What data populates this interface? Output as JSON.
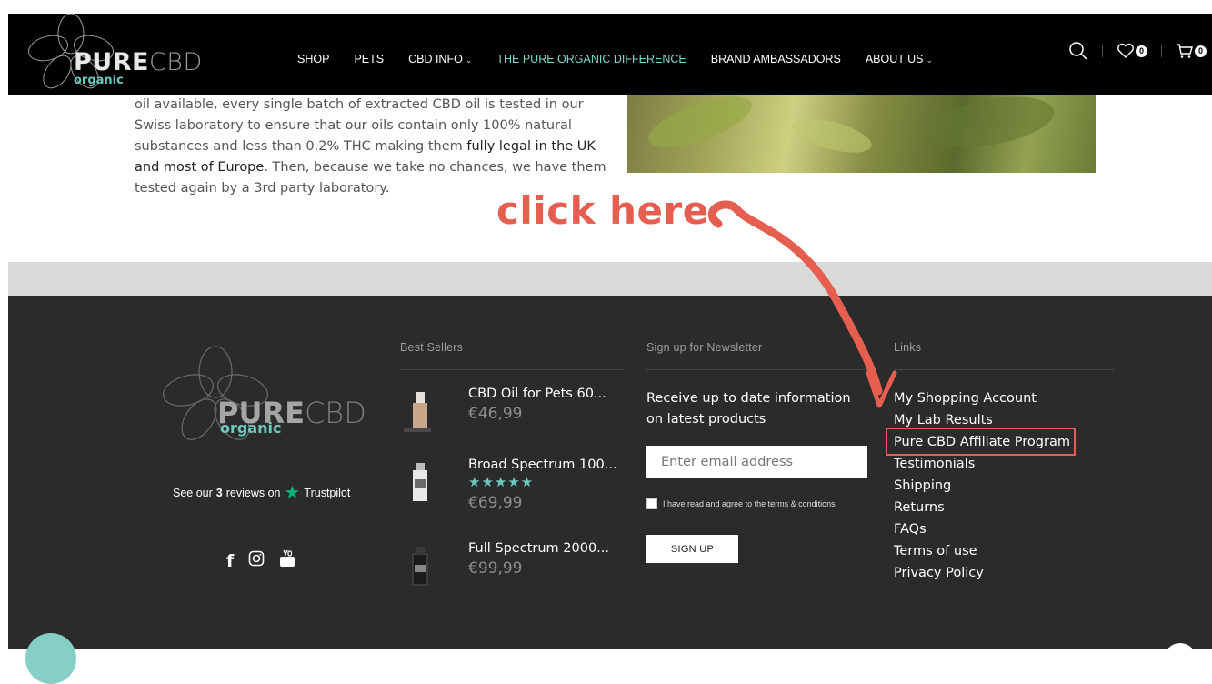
{
  "header": {
    "logo": {
      "pure_bold": "PURE",
      "pure_light": "CBD",
      "organic": "organic"
    },
    "nav": [
      {
        "label": "SHOP",
        "dropdown": false,
        "active": false
      },
      {
        "label": "PETS",
        "dropdown": false,
        "active": false
      },
      {
        "label": "CBD INFO",
        "dropdown": true,
        "active": false
      },
      {
        "label": "THE PURE ORGANIC DIFFERENCE",
        "dropdown": false,
        "active": true
      },
      {
        "label": "BRAND AMBASSADORS",
        "dropdown": false,
        "active": false
      },
      {
        "label": "ABOUT US",
        "dropdown": true,
        "active": false
      }
    ],
    "caret": "⌄",
    "wishlist_count": "0",
    "cart_count": "0"
  },
  "content": {
    "para_1": "oil available, every single batch of extracted CBD oil is tested in our Swiss laboratory to ensure that our oils contain only 100% natural substances and less than 0.2% THC making them ",
    "para_bold": "fully legal in the UK and most of Europe",
    "para_2": ". Then, because we take no chances, we have them tested again by a 3rd party laboratory."
  },
  "annotation": {
    "text": "click here",
    "color": "#e65e4f"
  },
  "footer": {
    "logo": {
      "pure_bold": "PURE",
      "pure_light": "CBD",
      "organic": "organic"
    },
    "trustpilot": {
      "prefix": "See our",
      "count": "3",
      "suffix": "reviews on",
      "brand": "Trustpilot"
    },
    "best_sellers": {
      "heading": "Best Sellers",
      "products": [
        {
          "name": "CBD Oil for Pets 60...",
          "price": "€46,99",
          "stars": ""
        },
        {
          "name": "Broad Spectrum 100...",
          "price": "€69,99",
          "stars": "★★★★★"
        },
        {
          "name": "Full Spectrum 2000...",
          "price": "€99,99",
          "stars": ""
        }
      ]
    },
    "newsletter": {
      "heading": "Sign up for Newsletter",
      "text": "Receive up to date information on latest products",
      "placeholder": "Enter email address",
      "checkbox_label": "I have read and agree to the terms & conditions",
      "button": "SIGN UP"
    },
    "links": {
      "heading": "Links",
      "items": [
        "My Shopping Account",
        "My Lab Results",
        "Pure CBD Affiliate Program",
        "Testimonials",
        "Shipping",
        "Returns",
        "FAQs",
        "Terms of use",
        "Privacy Policy"
      ]
    }
  },
  "colors": {
    "accent": "#7fd6cc",
    "annotation": "#e65e4f",
    "footer_bg": "#2b2b2b",
    "trustpilot": "#00b67a"
  }
}
